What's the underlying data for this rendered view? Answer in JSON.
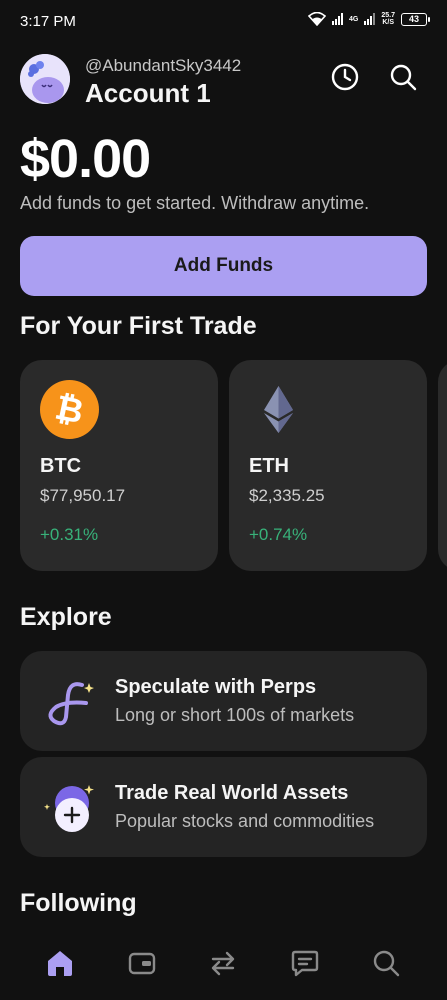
{
  "status_bar": {
    "time": "3:17 PM",
    "network_label": "4G",
    "speed_value": "25.7",
    "speed_unit": "K/S",
    "battery": "43"
  },
  "header": {
    "username": "@AbundantSky3442",
    "account_name": "Account 1",
    "icons": [
      "avatar",
      "history-icon",
      "search-icon"
    ]
  },
  "balance": {
    "amount": "$0.00",
    "subtitle": "Add funds to get started. Withdraw anytime."
  },
  "add_funds_label": "Add Funds",
  "first_trade": {
    "title": "For Your First Trade",
    "cards": [
      {
        "symbol": "BTC",
        "price": "$77,950.17",
        "change": "+0.31%",
        "icon": "bitcoin-icon",
        "color": "#f7931a"
      },
      {
        "symbol": "ETH",
        "price": "$2,335.25",
        "change": "+0.74%",
        "icon": "ethereum-icon",
        "color": "#8a92b2"
      }
    ]
  },
  "explore": {
    "title": "Explore",
    "items": [
      {
        "title": "Speculate with Perps",
        "subtitle": "Long or short 100s of markets",
        "icon": "perps-icon"
      },
      {
        "title": "Trade Real World Assets",
        "subtitle": "Popular stocks and commodities",
        "icon": "rwa-icon"
      }
    ]
  },
  "following_title": "Following",
  "bottom_nav": {
    "items": [
      "home-icon",
      "wallet-icon",
      "swap-icon",
      "chat-icon",
      "search-icon"
    ],
    "active": "home-icon"
  },
  "colors": {
    "accent": "#ab9ff2",
    "positive": "#38b27a",
    "background": "#111111",
    "card": "#2a2a2a"
  }
}
